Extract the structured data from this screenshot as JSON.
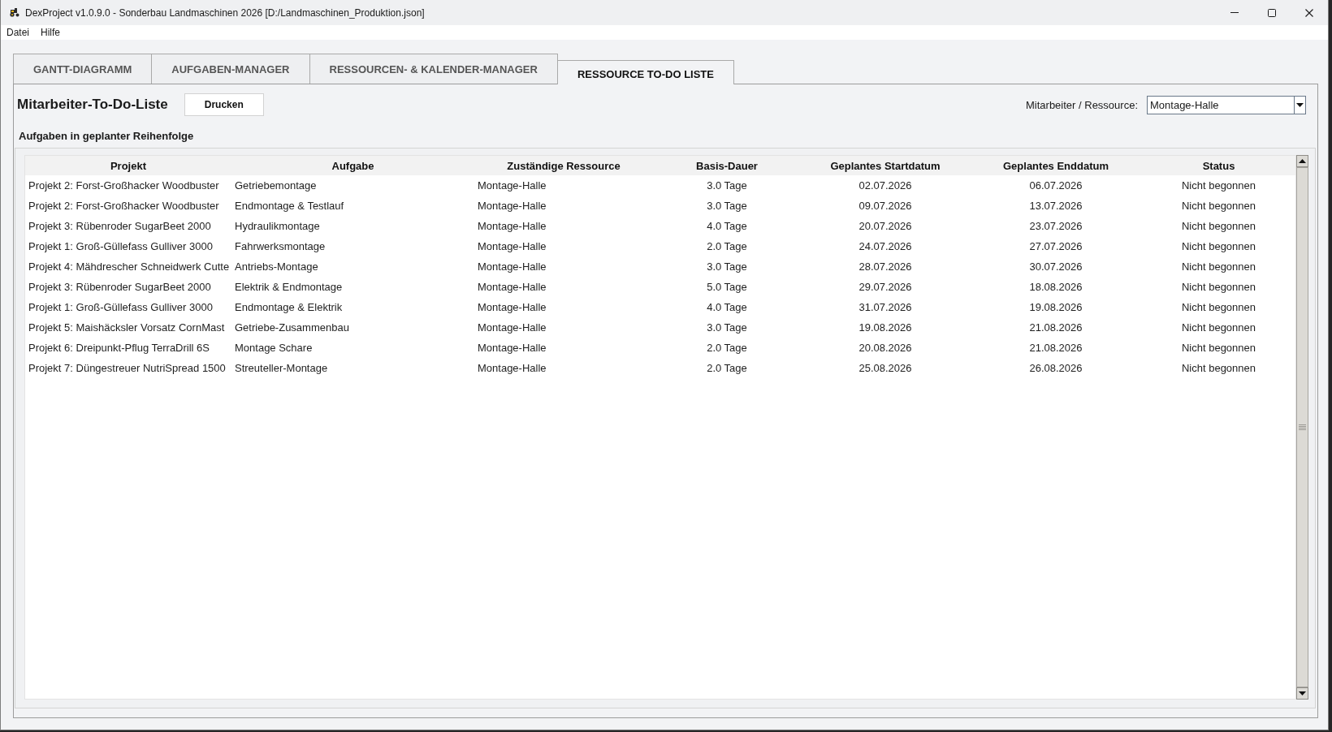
{
  "window": {
    "title": "DexProject v1.0.9.0 - Sonderbau Landmaschinen 2026 [D:/Landmaschinen_Produktion.json]"
  },
  "menu": [
    "Datei",
    "Hilfe"
  ],
  "tabs": [
    {
      "label": "GANTT-DIAGRAMM",
      "selected": false
    },
    {
      "label": "AUFGABEN-MANAGER",
      "selected": false
    },
    {
      "label": "RESSOURCEN- & KALENDER-MANAGER",
      "selected": false
    },
    {
      "label": "RESSOURCE TO-DO LISTE",
      "selected": true
    }
  ],
  "panel": {
    "title": "Mitarbeiter-To-Do-Liste",
    "print_button": "Drucken",
    "resource_filter": {
      "label": "Mitarbeiter / Ressource:",
      "value": "Montage-Halle"
    },
    "subtitle": "Aufgaben in geplanter Reihenfolge",
    "table": {
      "columns": [
        "Projekt",
        "Aufgabe",
        "Zuständige Ressource",
        "Basis-Dauer",
        "Geplantes Startdatum",
        "Geplantes Enddatum",
        "Status"
      ],
      "rows": [
        [
          "Projekt 2: Forst-Großhacker Woodbuster",
          "Getriebemontage",
          "Montage-Halle",
          "3.0 Tage",
          "02.07.2026",
          "06.07.2026",
          "Nicht begonnen"
        ],
        [
          "Projekt 2: Forst-Großhacker Woodbuster",
          "Endmontage & Testlauf",
          "Montage-Halle",
          "3.0 Tage",
          "09.07.2026",
          "13.07.2026",
          "Nicht begonnen"
        ],
        [
          "Projekt 3: Rübenroder SugarBeet 2000",
          "Hydraulikmontage",
          "Montage-Halle",
          "4.0 Tage",
          "20.07.2026",
          "23.07.2026",
          "Nicht begonnen"
        ],
        [
          "Projekt 1: Groß-Güllefass Gulliver 3000",
          "Fahrwerksmontage",
          "Montage-Halle",
          "2.0 Tage",
          "24.07.2026",
          "27.07.2026",
          "Nicht begonnen"
        ],
        [
          "Projekt 4: Mähdrescher Schneidwerk Cutte",
          "Antriebs-Montage",
          "Montage-Halle",
          "3.0 Tage",
          "28.07.2026",
          "30.07.2026",
          "Nicht begonnen"
        ],
        [
          "Projekt 3: Rübenroder SugarBeet 2000",
          "Elektrik & Endmontage",
          "Montage-Halle",
          "5.0 Tage",
          "29.07.2026",
          "18.08.2026",
          "Nicht begonnen"
        ],
        [
          "Projekt 1: Groß-Güllefass Gulliver 3000",
          "Endmontage & Elektrik",
          "Montage-Halle",
          "4.0 Tage",
          "31.07.2026",
          "19.08.2026",
          "Nicht begonnen"
        ],
        [
          "Projekt 5: Maishäcksler Vorsatz CornMast",
          "Getriebe-Zusammenbau",
          "Montage-Halle",
          "3.0 Tage",
          "19.08.2026",
          "21.08.2026",
          "Nicht begonnen"
        ],
        [
          "Projekt 6: Dreipunkt-Pflug TerraDrill 6S",
          "Montage Schare",
          "Montage-Halle",
          "2.0 Tage",
          "20.08.2026",
          "21.08.2026",
          "Nicht begonnen"
        ],
        [
          "Projekt 7: Düngestreuer NutriSpread 1500",
          "Streuteller-Montage",
          "Montage-Halle",
          "2.0 Tage",
          "25.08.2026",
          "26.08.2026",
          "Nicht begonnen"
        ]
      ]
    }
  }
}
